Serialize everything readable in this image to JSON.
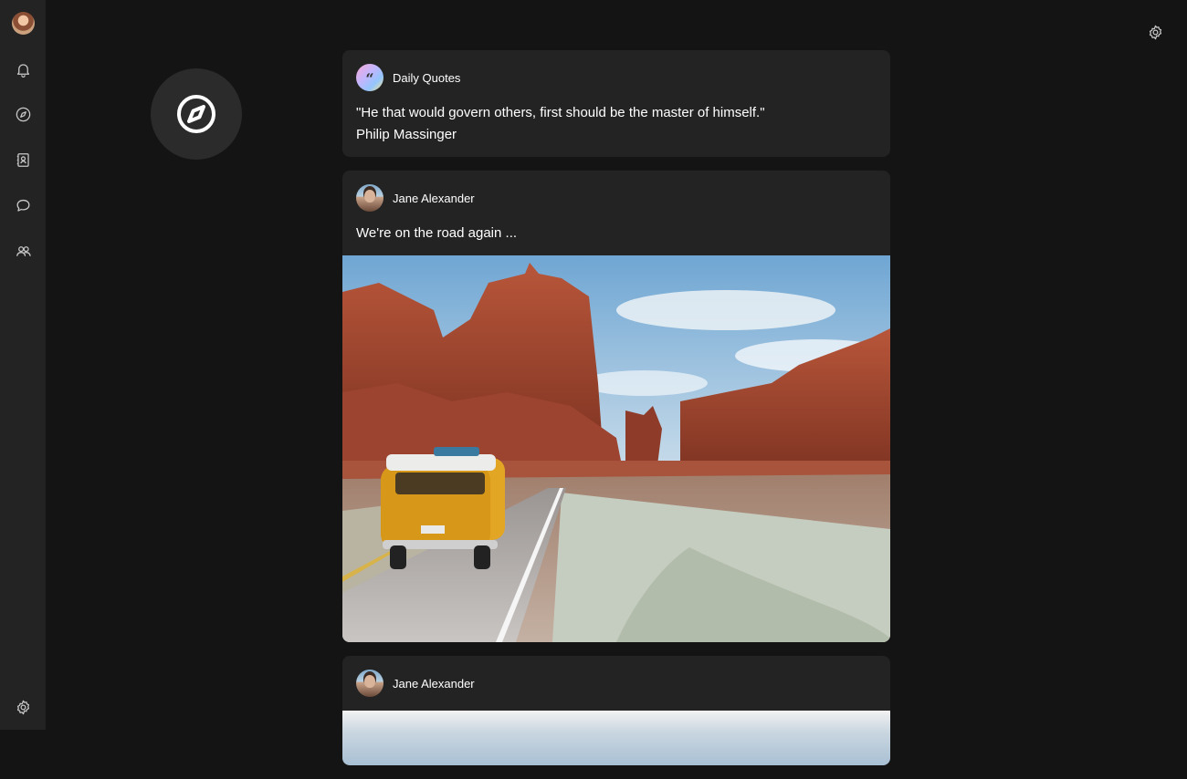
{
  "sidebar": {
    "avatar": "user-avatar",
    "items": [
      {
        "icon": "bell-icon"
      },
      {
        "icon": "compass-icon"
      },
      {
        "icon": "contacts-book-icon"
      },
      {
        "icon": "chat-bubble-icon"
      },
      {
        "icon": "people-icon"
      }
    ],
    "bottom_icon": "gear-icon"
  },
  "header": {
    "settings_icon": "gear-icon"
  },
  "explore_icon": "compass-icon",
  "feed": {
    "posts": [
      {
        "author": "Daily Quotes",
        "lines": [
          "\"He that would govern others, first should be the master of himself.\"",
          "Philip Massinger"
        ]
      },
      {
        "author": "Jane Alexander",
        "text": "We're on the road again ...",
        "image": "desert-road-van-photo"
      },
      {
        "author": "Jane Alexander",
        "image": "sky-photo"
      }
    ]
  },
  "colors": {
    "background": "#141414",
    "sidebar": "#232323",
    "card": "#232323",
    "icon": "#c9c9c9"
  }
}
